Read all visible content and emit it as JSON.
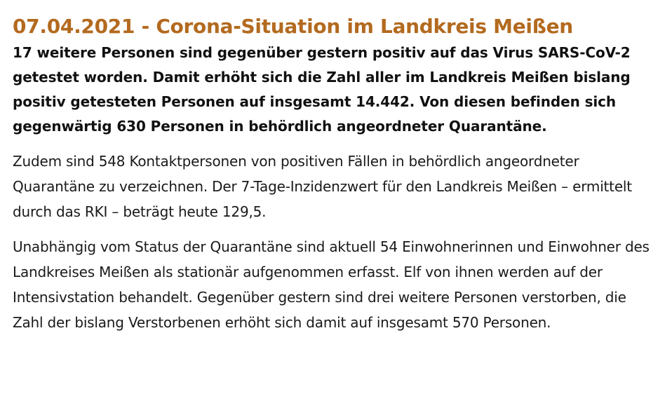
{
  "article": {
    "headline": "07.04.2021 - Corona-Situation im Landkreis Meißen",
    "lead": "17 weitere Personen sind gegenüber gestern positiv auf das Virus SARS-CoV-2 getestet worden. Damit erhöht sich die Zahl aller im Landkreis Meißen bislang positiv getesteten Personen auf insgesamt 14.442. Von diesen befinden sich gegenwärtig 630 Personen in behördlich angeordneter Quarantäne.",
    "paragraph_1": "Zudem sind 548 Kontaktpersonen von positiven Fällen in behördlich angeordneter Quarantäne zu verzeichnen. Der 7-Tage-Inzidenzwert für den Landkreis Meißen – ermittelt durch das RKI – beträgt heute 129,5.",
    "paragraph_2": "Unabhängig vom Status der Quarantäne sind aktuell 54 Einwohnerinnen und Einwohner des Landkreises Meißen als stationär aufgenommen erfasst. Elf von ihnen werden auf der Intensivstation behandelt. Gegenüber gestern sind drei weitere Personen verstorben, die Zahl der bislang Verstorbenen erhöht sich damit auf insgesamt 570 Personen."
  },
  "colors": {
    "headline": "#b36a1f",
    "text": "#111111",
    "background": "#ffffff"
  }
}
